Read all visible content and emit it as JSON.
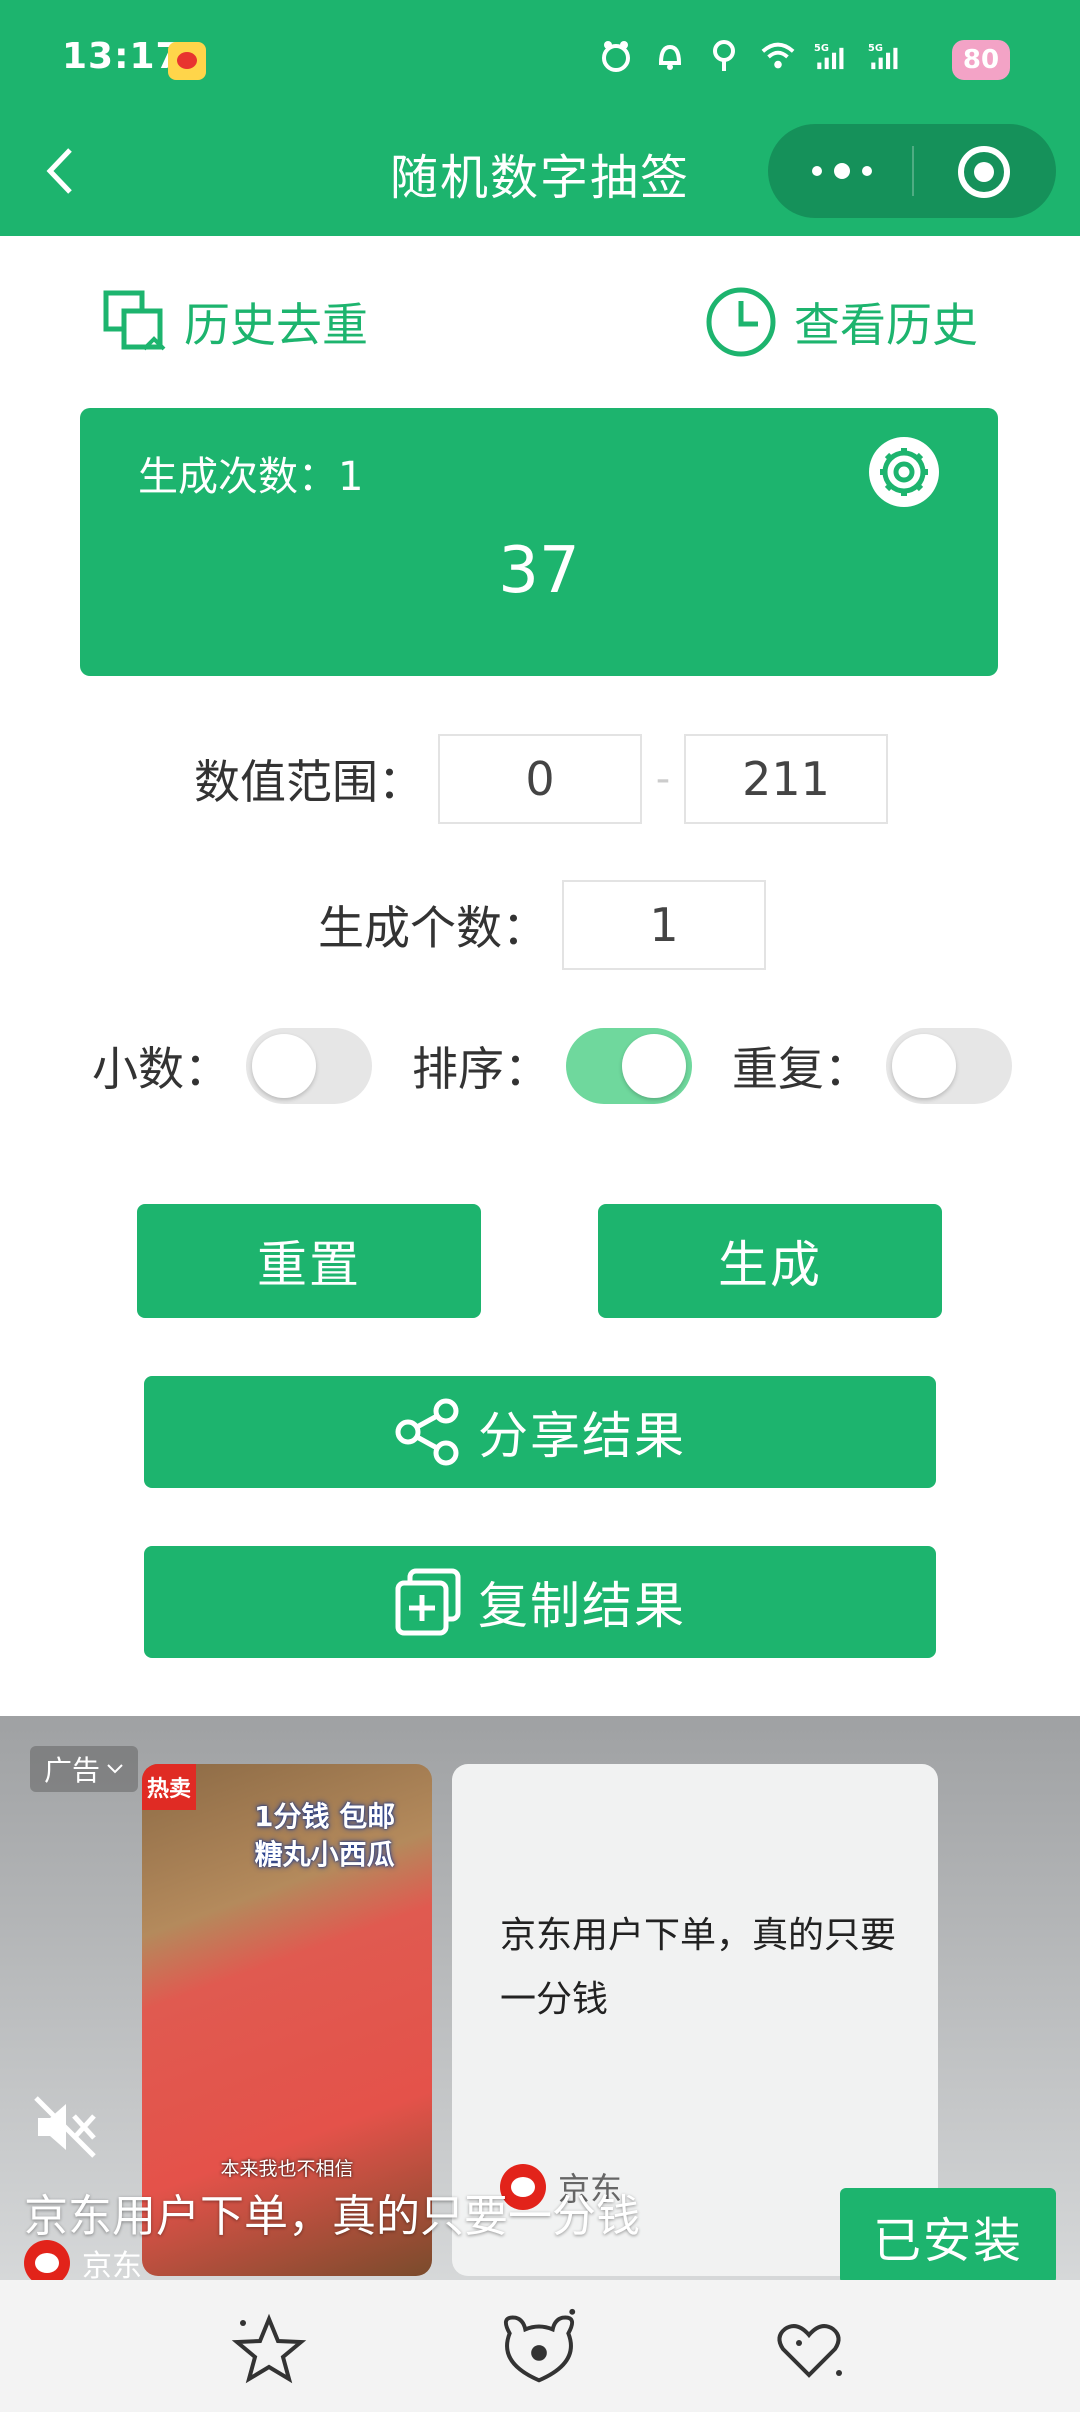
{
  "status_bar": {
    "time": "13:17",
    "battery": "80",
    "network": "5G"
  },
  "header": {
    "title": "随机数字抽签"
  },
  "links": {
    "history_dedup": "历史去重",
    "view_history": "查看历史"
  },
  "result": {
    "count_label": "生成次数：1",
    "value": "37"
  },
  "range": {
    "label": "数值范围：",
    "min": "0",
    "separator": "-",
    "max": "211"
  },
  "quantity": {
    "label": "生成个数：",
    "value": "1"
  },
  "options": {
    "decimal_label": "小数：",
    "decimal_on": false,
    "sort_label": "排序：",
    "sort_on": true,
    "repeat_label": "重复：",
    "repeat_on": false
  },
  "buttons": {
    "reset": "重置",
    "generate": "生成",
    "share": "分享结果",
    "copy": "复制结果"
  },
  "ad": {
    "tag": "广告",
    "hot_badge": "热卖",
    "promo_line1": "1分钱 包邮",
    "promo_line2": "糖丸小西瓜",
    "video_caption": "本来我也不相信",
    "description": "京东用户下单，真的只要一分钱",
    "brand": "京东",
    "overlay_title": "京东用户下单，真的只要一分钱",
    "install_button": "已安装"
  },
  "colors": {
    "primary": "#1db46e",
    "primary_dark": "#15915a",
    "toggle_on": "#6fd89d"
  }
}
